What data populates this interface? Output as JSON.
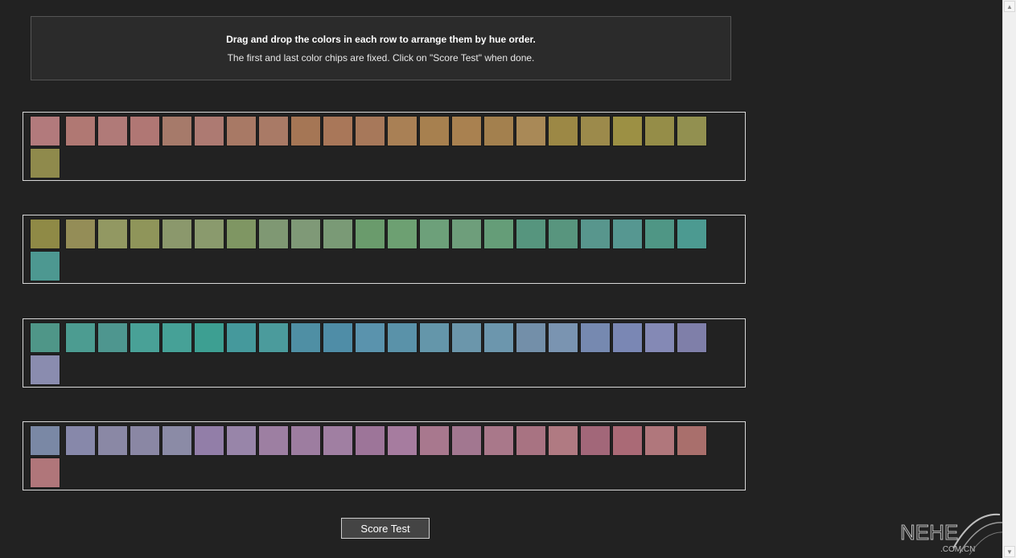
{
  "instructions": {
    "title": "Drag and drop the colors in each row to arrange them by hue order.",
    "subtitle": "The first and last color chips are fixed. Click on \"Score Test\" when done."
  },
  "rows": [
    {
      "name": "row-1",
      "fixed_start": "#b27a7c",
      "fixed_end": "#8f8a4c",
      "chips": [
        "#b07873",
        "#b07a78",
        "#b07774",
        "#a67a6a",
        "#ad7a72",
        "#a87965",
        "#a97a66",
        "#a57655",
        "#a97759",
        "#a7785a",
        "#a98055",
        "#a7804f",
        "#a98150",
        "#a3804e",
        "#a98957",
        "#9c8845",
        "#9c8a4b",
        "#9c9044",
        "#958d48",
        "#929050"
      ]
    },
    {
      "name": "row-2",
      "fixed_start": "#8f8a46",
      "fixed_end": "#4d9891",
      "chips": [
        "#948d57",
        "#929862",
        "#8f955a",
        "#8b986c",
        "#8a9a6d",
        "#7f9663",
        "#7f9873",
        "#7f9977",
        "#7a9a76",
        "#6a9b6c",
        "#6da072",
        "#6da07a",
        "#6e9e7b",
        "#659d78",
        "#56957e",
        "#58957e",
        "#58968d",
        "#569791",
        "#4f9685",
        "#4c9a91"
      ]
    },
    {
      "name": "row-3",
      "fixed_start": "#4f9688",
      "fixed_end": "#8a8caf",
      "chips": [
        "#4c9c91",
        "#4e968f",
        "#49a197",
        "#46a197",
        "#3d9f92",
        "#45999c",
        "#4b9b9c",
        "#4f8fa4",
        "#4f8da7",
        "#5a93ad",
        "#5a92a9",
        "#6496aa",
        "#6b96ab",
        "#6c96ad",
        "#738fa9",
        "#7a94b1",
        "#7689b0",
        "#7a87b4",
        "#8489b5",
        "#7f7fa9"
      ]
    },
    {
      "name": "row-4",
      "fixed_start": "#7a88a5",
      "fixed_end": "#b0767a",
      "chips": [
        "#8788aa",
        "#8a88a5",
        "#8a87a4",
        "#8b8ba6",
        "#927ea8",
        "#9885a9",
        "#9d7fa2",
        "#9d7da0",
        "#a07fa2",
        "#9d7599",
        "#a67c9f",
        "#a8788e",
        "#a27790",
        "#a9788a",
        "#a87382",
        "#b07a82",
        "#a26779",
        "#aa6a76",
        "#b0777c",
        "#a96f6c"
      ]
    }
  ],
  "buttons": {
    "score_label": "Score Test"
  },
  "watermark": {
    "brand": "NEHE",
    "domain": ".COM.CN"
  },
  "scrollbar": {
    "up_icon": "chevron-up-icon",
    "down_icon": "chevron-down-icon"
  }
}
